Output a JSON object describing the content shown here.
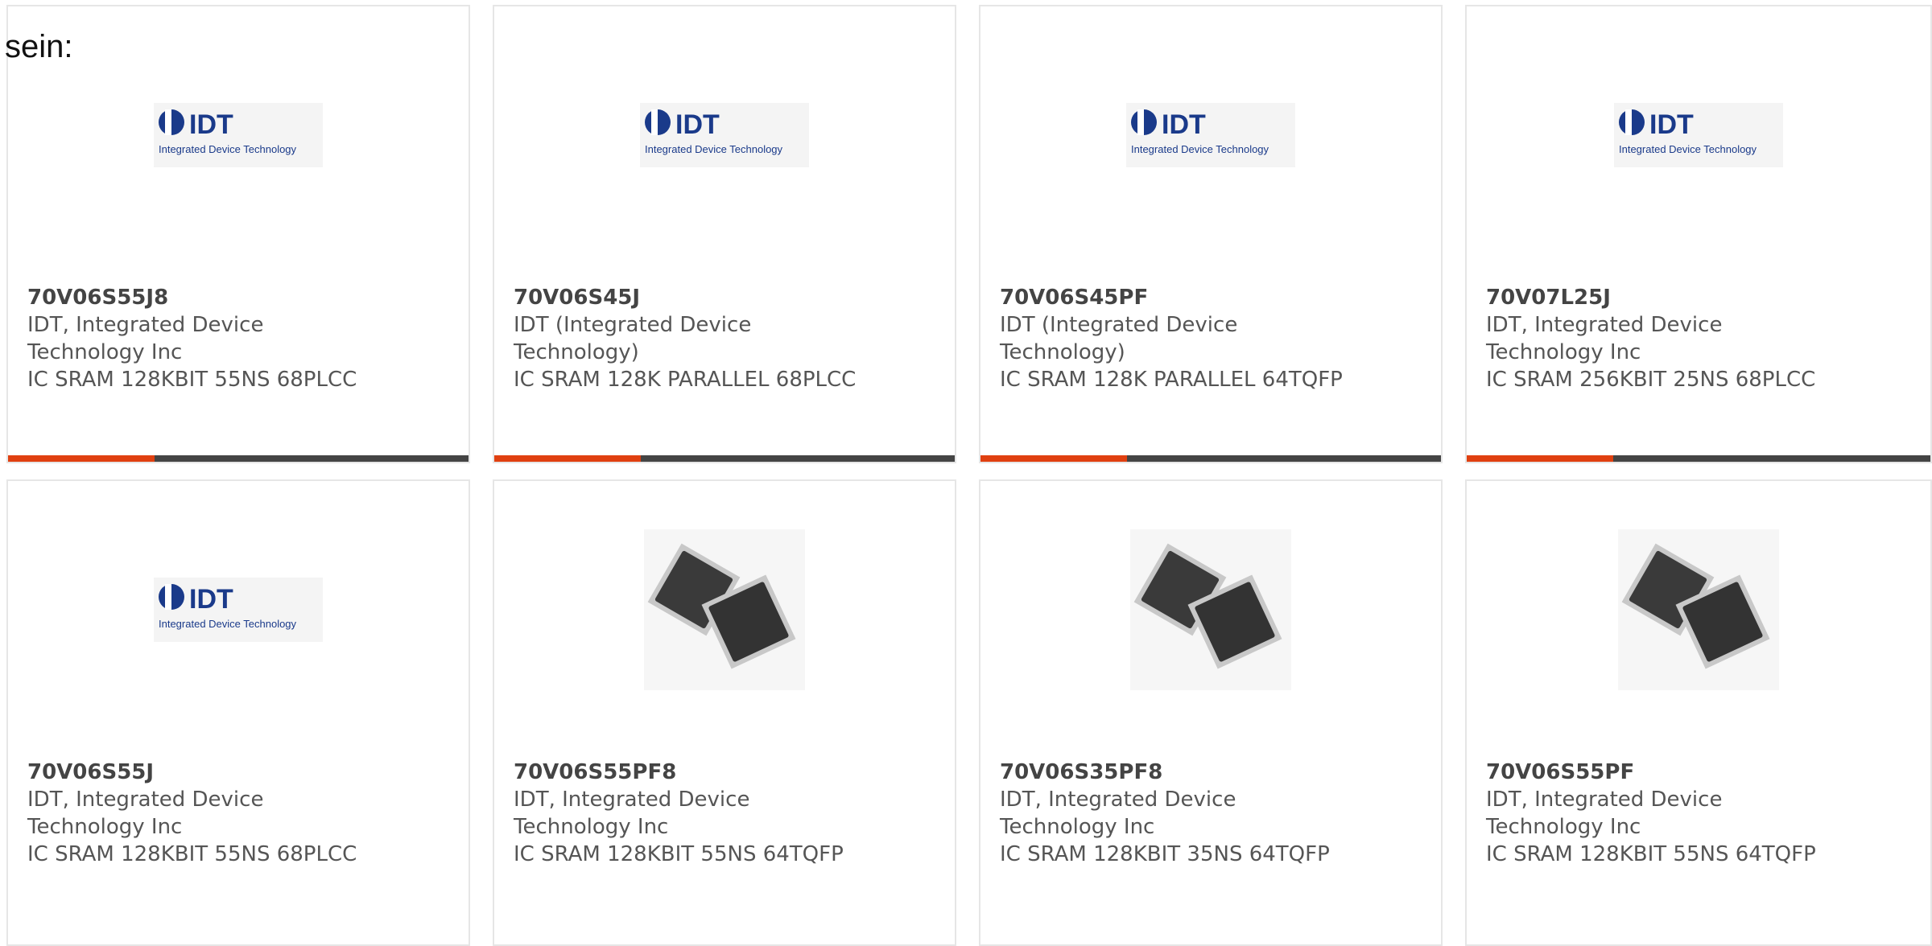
{
  "prefix_text": "sein:",
  "logo": {
    "mark": "IDT",
    "subtitle": "Integrated Device Technology",
    "brand_color": "#1a3a8a"
  },
  "accent_color": "#e04010",
  "products": [
    {
      "part": "70V06S55J8",
      "manufacturer": "IDT, Integrated Device\nTechnology Inc",
      "description": "IC SRAM 128KBIT 55NS 68PLCC",
      "image": "idt-logo"
    },
    {
      "part": "70V06S45J",
      "manufacturer": "IDT (Integrated Device\nTechnology)",
      "description": "IC SRAM 128K PARALLEL 68PLCC",
      "image": "idt-logo"
    },
    {
      "part": "70V06S45PF",
      "manufacturer": "IDT (Integrated Device\nTechnology)",
      "description": "IC SRAM 128K PARALLEL 64TQFP",
      "image": "idt-logo"
    },
    {
      "part": "70V07L25J",
      "manufacturer": "IDT, Integrated Device\nTechnology Inc",
      "description": "IC SRAM 256KBIT 25NS 68PLCC",
      "image": "idt-logo"
    },
    {
      "part": "70V06S55J",
      "manufacturer": "IDT, Integrated Device\nTechnology Inc",
      "description": "IC SRAM 128KBIT 55NS 68PLCC",
      "image": "idt-logo"
    },
    {
      "part": "70V06S55PF8",
      "manufacturer": "IDT, Integrated Device\nTechnology Inc",
      "description": "IC SRAM 128KBIT 55NS 64TQFP",
      "image": "chip"
    },
    {
      "part": "70V06S35PF8",
      "manufacturer": "IDT, Integrated Device\nTechnology Inc",
      "description": "IC SRAM 128KBIT 35NS 64TQFP",
      "image": "chip"
    },
    {
      "part": "70V06S55PF",
      "manufacturer": "IDT, Integrated Device\nTechnology Inc",
      "description": "IC SRAM 128KBIT 55NS 64TQFP",
      "image": "chip"
    }
  ]
}
